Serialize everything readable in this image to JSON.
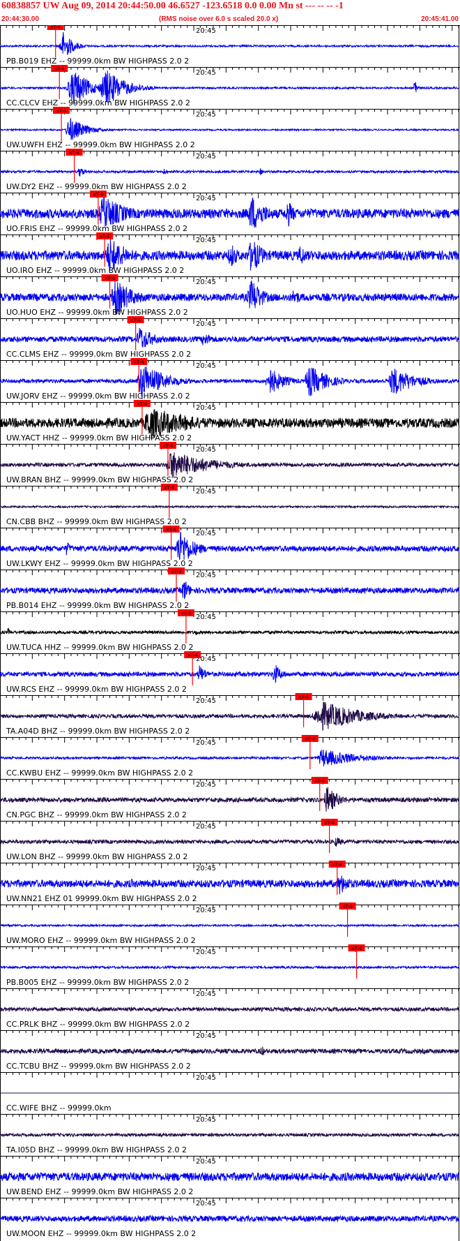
{
  "header": {
    "title": "60838857 UW Aug 09, 2014 20:44:50.00   46.6527 -123.6518  0.0 0.00 Mn st --- -- --  -1",
    "start_time": "20:44:30.00",
    "subtitle": "(RMS noise over 6.0 s scaled 20.0 x)",
    "end_time": "20:45:41.00"
  },
  "colors": {
    "blue": "#0000ee",
    "black": "#000000",
    "navy": "#1f0a46",
    "pick": "#ff0000",
    "grid": "#000000"
  },
  "chart_data": {
    "type": "line",
    "title": "60838857 UW Aug 09, 2014 20:44:50.00   46.6527 -123.6518  0.0 0.00 Mn st --- -- --  -1",
    "x_start": "20:44:30.00",
    "x_end": "20:45:41.00",
    "x_range_seconds": [
      0,
      71
    ],
    "minute_tick_label": "20:45",
    "minute_tick_seconds": 30,
    "pick_label": "xT-4",
    "grid": true,
    "traces": [
      {
        "label": "PB.B019 EHZ -- 99999.0km BW  HIGHPASS  2.0  2",
        "color": "blue",
        "pick": 8.6,
        "pick_len": 4.5,
        "noise": 0.05,
        "events": [
          [
            9,
            0.8,
            0.8,
            2.5
          ]
        ],
        "label_color": "black"
      },
      {
        "label": "CC.CLCV EHZ -- 99999.0km BW  HIGHPASS  2.0  2",
        "color": "blue",
        "pick": 9.2,
        "pick_len": 4.5,
        "noise": 0.05,
        "events": [
          [
            10,
            1.0,
            1.5,
            4
          ],
          [
            15,
            1.0,
            1.5,
            5
          ],
          [
            64,
            0.8,
            0.2,
            0.5
          ]
        ],
        "label_color": "black"
      },
      {
        "label": "UW.UWFH EHZ -- 99999.0km BW  HIGHPASS  2.0  2",
        "color": "blue",
        "pick": 9.5,
        "pick_len": 4.5,
        "noise": 0.04,
        "events": [
          [
            10,
            0.7,
            0.8,
            4
          ]
        ],
        "label_color": "black"
      },
      {
        "label": "UW.DY2 EHZ -- 99999.0km BW  HIGHPASS  2.0  2",
        "color": "blue",
        "pick": 11.5,
        "pick_len": 4.5,
        "noise": 0.06,
        "events": [
          [
            12,
            0.3,
            0.3,
            1.5
          ],
          [
            25,
            0.2,
            0.3,
            1
          ],
          [
            40,
            0.2,
            0.3,
            1
          ]
        ],
        "label_color": "black"
      },
      {
        "label": "UO.FRIS EHZ -- 99999.0km BW  HIGHPASS  2.0  2",
        "color": "blue",
        "pick": 15.2,
        "pick_len": 4.5,
        "noise": 0.25,
        "events": [
          [
            15,
            1.0,
            1.0,
            6
          ],
          [
            38,
            1.0,
            1.0,
            4
          ],
          [
            44,
            0.8,
            0.5,
            2
          ]
        ],
        "label_color": "black"
      },
      {
        "label": "UO.IRO EHZ -- 99999.0km BW  HIGHPASS  2.0  2",
        "color": "blue",
        "pick": 16.2,
        "pick_len": 4.5,
        "noise": 0.25,
        "events": [
          [
            16,
            1.0,
            1.0,
            5
          ],
          [
            35,
            0.7,
            0.8,
            2
          ],
          [
            38,
            1.0,
            1.0,
            3
          ],
          [
            46,
            0.6,
            0.5,
            2
          ]
        ],
        "label_color": "black"
      },
      {
        "label": "UO.HUO EHZ -- 99999.0km BW  HIGHPASS  2.0  2",
        "color": "blue",
        "pick": 17.0,
        "pick_len": 4.5,
        "noise": 0.2,
        "events": [
          [
            17,
            1.0,
            0.8,
            5
          ],
          [
            38,
            1.0,
            1.0,
            3
          ],
          [
            45,
            0.5,
            0.5,
            2
          ]
        ],
        "label_color": "black"
      },
      {
        "label": "CC.CLMS EHZ -- 99999.0km BW  HIGHPASS  2.0  2",
        "color": "blue",
        "pick": 21.0,
        "pick_len": 4.5,
        "noise": 0.15,
        "events": [
          [
            21,
            0.7,
            0.6,
            4
          ],
          [
            31,
            0.4,
            0.5,
            3
          ]
        ],
        "label_color": "black"
      },
      {
        "label": "UW.JORV EHZ -- 99999.0km BW  HIGHPASS  2.0  2",
        "color": "blue",
        "pick": 21.5,
        "pick_len": 4.5,
        "noise": 0.1,
        "events": [
          [
            21,
            1.0,
            1.0,
            6
          ],
          [
            41,
            0.8,
            0.6,
            4
          ],
          [
            47,
            0.9,
            0.8,
            5
          ],
          [
            60,
            0.8,
            0.8,
            6
          ]
        ],
        "label_color": "black"
      },
      {
        "label": "UW.YACT HHZ -- 99999.0km BW  HIGHPASS  2.0  2",
        "color": "black",
        "pick": 22.0,
        "pick_len": 4.5,
        "noise": 0.25,
        "events": [
          [
            22,
            0.9,
            1.0,
            12
          ]
        ],
        "label_color": "black"
      },
      {
        "label": "UW.BRAN BHZ -- 99999.0km BW  HIGHPASS  2.0  2",
        "color": "navy",
        "pick": 26.0,
        "pick_len": 4.5,
        "noise": 0.1,
        "events": [
          [
            25.5,
            0.8,
            1.0,
            10
          ]
        ],
        "label_color": "black"
      },
      {
        "label": "CN.CBB BHZ -- 99999.0km BW  HIGHPASS  2.0  2",
        "color": "navy",
        "pick": 26.2,
        "pick_len": 4.5,
        "noise": 0.05,
        "events": [],
        "label_color": "black"
      },
      {
        "label": "UW.LKWY EHZ -- 99999.0km BW  HIGHPASS  2.0  2",
        "color": "blue",
        "pick": 26.5,
        "pick_len": 4.5,
        "noise": 0.15,
        "events": [
          [
            10,
            0.4,
            0.3,
            1.5
          ],
          [
            27,
            1.0,
            0.8,
            4
          ]
        ],
        "label_color": "black"
      },
      {
        "label": "PB.B014 EHZ -- 99999.0km BW  HIGHPASS  2.0  2",
        "color": "blue",
        "pick": 27.3,
        "pick_len": 4.5,
        "noise": 0.15,
        "events": [
          [
            28,
            0.7,
            0.5,
            1.5
          ]
        ],
        "label_color": "black"
      },
      {
        "label": "UW.TUCA HHZ -- 99999.0km BW  HIGHPASS  2.0  2",
        "color": "black",
        "pick": 28.8,
        "pick_len": 4.5,
        "noise": 0.08,
        "events": [
          [
            1,
            0.25,
            0.3,
            0.8
          ],
          [
            30,
            0.2,
            0.3,
            0.8
          ]
        ],
        "label_color": "black"
      },
      {
        "label": "UW.RCS EHZ -- 99999.0km BW  HIGHPASS  2.0  2",
        "color": "blue",
        "pick": 29.8,
        "pick_len": 4.5,
        "noise": 0.12,
        "events": [
          [
            30.5,
            0.5,
            0.4,
            2
          ],
          [
            42,
            0.6,
            0.5,
            2
          ]
        ],
        "label_color": "black"
      },
      {
        "label": "TA.A04D BHZ -- 99999.0km BW  HIGHPASS  2.0  2",
        "color": "navy",
        "pick": 47.0,
        "pick_len": 4.5,
        "noise": 0.1,
        "events": [
          [
            48,
            0.8,
            2.0,
            10
          ]
        ],
        "label_color": "black"
      },
      {
        "label": "CC.KWBU EHZ -- 99999.0km BW  HIGHPASS  2.0  2",
        "color": "blue",
        "pick": 48.0,
        "pick_len": 4.5,
        "noise": 0.06,
        "events": [
          [
            49,
            0.5,
            0.8,
            10
          ]
        ],
        "label_color": "black"
      },
      {
        "label": "CN.PGC BHZ -- 99999.0km BW  HIGHPASS  2.0  2",
        "color": "navy",
        "pick": 49.5,
        "pick_len": 4.5,
        "noise": 0.12,
        "events": [
          [
            50,
            0.8,
            0.6,
            3
          ]
        ],
        "label_color": "black"
      },
      {
        "label": "UW.LON BHZ -- 99999.0km BW  HIGHPASS  2.0  2",
        "color": "navy",
        "pick": 51.0,
        "pick_len": 4.5,
        "noise": 0.1,
        "events": [
          [
            51.5,
            0.3,
            0.5,
            2
          ]
        ],
        "label_color": "black"
      },
      {
        "label": "UW.NN21 EHZ 01 99999.0km BW  HIGHPASS  2.0  2",
        "color": "blue",
        "pick": 52.2,
        "pick_len": 4.5,
        "noise": 0.2,
        "events": [
          [
            20,
            0.3,
            0.3,
            1
          ],
          [
            52,
            0.6,
            0.6,
            3
          ]
        ],
        "label_color": "black"
      },
      {
        "label": "UW.MORO EHZ -- 99999.0km BW  HIGHPASS  2.0  2",
        "color": "blue",
        "pick": 53.8,
        "pick_len": 4.5,
        "noise": 0.05,
        "events": [],
        "label_color": "black"
      },
      {
        "label": "PB.B005 EHZ -- 99999.0km BW  HIGHPASS  2.0  2",
        "color": "blue",
        "pick": 55.2,
        "pick_len": 4.5,
        "noise": 0.06,
        "events": [],
        "label_color": "black"
      },
      {
        "label": "CC.PRLK BHZ -- 99999.0km BW  HIGHPASS  2.0  2",
        "color": "navy",
        "pick": null,
        "noise": 0.1,
        "events": [],
        "label_color": "black"
      },
      {
        "label": "CC.TCBU BHZ -- 99999.0km BW  HIGHPASS  2.0  2",
        "color": "navy",
        "pick": null,
        "noise": 0.12,
        "events": [
          [
            40,
            0.3,
            0.5,
            1.5
          ]
        ],
        "label_color": "black"
      },
      {
        "label": "CC.WIFE BHZ -- 99999.0km",
        "color": "navy",
        "pick": null,
        "noise": 0.0,
        "events": [],
        "label_color": "black"
      },
      {
        "label": "TA.I05D BHZ -- 99999.0km BW  HIGHPASS  2.0  2",
        "color": "navy",
        "pick": null,
        "noise": 0.08,
        "events": [],
        "label_color": "black"
      },
      {
        "label": "UW.BEND EHZ -- 99999.0km BW  HIGHPASS  2.0  2",
        "color": "blue",
        "pick": null,
        "noise": 0.22,
        "events": [],
        "label_color": "black"
      },
      {
        "label": "UW.MOON EHZ -- 99999.0km BW  HIGHPASS  2.0  2",
        "color": "blue",
        "pick": null,
        "noise": 0.15,
        "events": [],
        "label_color": "black"
      }
    ]
  }
}
